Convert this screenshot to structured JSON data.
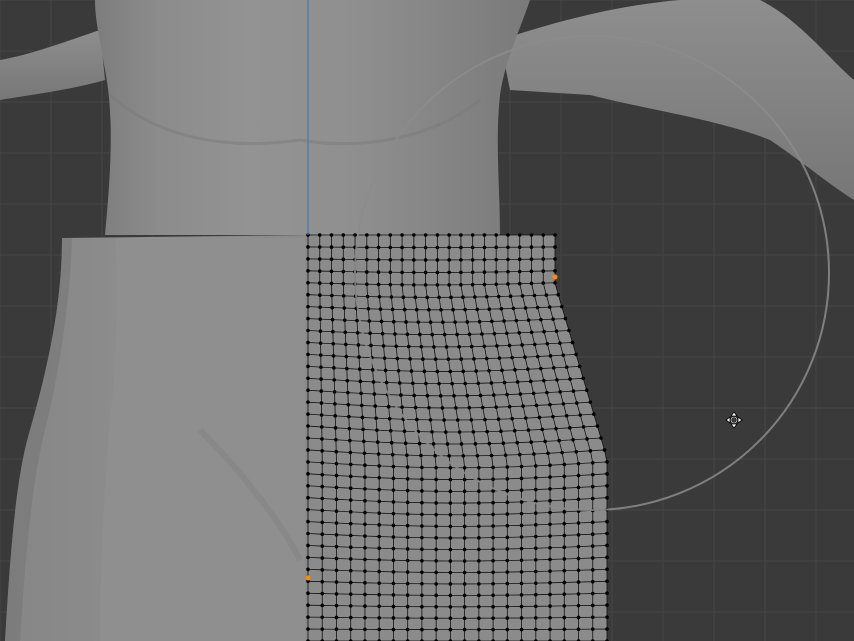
{
  "app": {
    "name": "",
    "mode": ""
  },
  "viewport": {
    "background_color": "#3a3a3a",
    "grid_color": "#454545",
    "mesh_color": "#8a8a8a",
    "wire_color": "#111111",
    "vertex_color": "#000000",
    "active_vertex_color": "#ff8a00",
    "axis_line_color": "#4a7ab0",
    "brush_circle_color": "#8c8c8c"
  },
  "icons": {
    "cursor": "move-cursor-icon"
  }
}
